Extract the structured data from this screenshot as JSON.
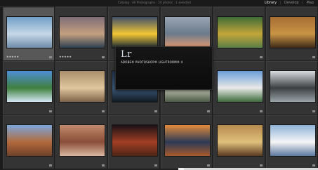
{
  "header": {
    "breadcrumb": "Catalog · All Photographs · 24 photos · 1 selected",
    "modules": [
      {
        "label": "Library",
        "active": true
      },
      {
        "label": "Develop",
        "active": false
      },
      {
        "label": "Map",
        "active": false
      }
    ]
  },
  "splash": {
    "logo": "Lr",
    "product": "ADOBE® PHOTOSHOP® LIGHTROOM® 4",
    "version": "",
    "credits": ""
  },
  "grid": {
    "rows": [
      [
        {
          "caption": "",
          "stars": "★★★★★",
          "palette": [
            "#6f9fc6",
            "#c7d7e7",
            "#6f8dab"
          ]
        },
        {
          "caption": "",
          "stars": "★★★★★",
          "palette": [
            "#7f6c78",
            "#c3a07f",
            "#2e4050"
          ]
        },
        {
          "caption": "",
          "stars": "",
          "palette": [
            "#3e4f6a",
            "#f2c634",
            "#1a2833"
          ]
        },
        {
          "caption": "",
          "stars": "",
          "palette": [
            "#9aa5b4",
            "#6a7b8b",
            "#e29b73"
          ]
        },
        {
          "caption": "",
          "stars": "",
          "palette": [
            "#3d6b37",
            "#c3a63a",
            "#5a7e44"
          ]
        },
        {
          "caption": "",
          "stars": "",
          "palette": [
            "#a76d33",
            "#c89445",
            "#3d2a18"
          ]
        }
      ],
      [
        {
          "caption": "",
          "stars": "",
          "palette": [
            "#4f8fd7",
            "#3f7f3f",
            "#d3e6f4"
          ]
        },
        {
          "caption": "",
          "stars": "",
          "palette": [
            "#a98f6b",
            "#e0c79e",
            "#7e6447"
          ]
        },
        {
          "caption": "",
          "stars": "",
          "palette": [
            "#22334a",
            "#3d5a7a",
            "#111a24"
          ]
        },
        {
          "caption": "",
          "stars": "",
          "palette": [
            "#6d7c6c",
            "#c5c7b7",
            "#4b5a45"
          ]
        },
        {
          "caption": "",
          "stars": "",
          "palette": [
            "#6a9ed7",
            "#e9e9e9",
            "#3b6a3b"
          ]
        },
        {
          "caption": "",
          "stars": "",
          "palette": [
            "#d9dde2",
            "#3b3f41",
            "#9aa3a8"
          ]
        }
      ],
      [
        {
          "caption": "",
          "stars": "",
          "palette": [
            "#7ca7d8",
            "#b2693d",
            "#6e4128"
          ]
        },
        {
          "caption": "",
          "stars": "",
          "palette": [
            "#c08a6b",
            "#8a4d38",
            "#d9b7a1"
          ]
        },
        {
          "caption": "",
          "stars": "",
          "palette": [
            "#1c1218",
            "#a03e24",
            "#4f2415"
          ]
        },
        {
          "caption": "",
          "stars": "",
          "palette": [
            "#e18b3b",
            "#2b3a55",
            "#a85a2d"
          ]
        },
        {
          "caption": "",
          "stars": "",
          "palette": [
            "#b68a4f",
            "#e0c07a",
            "#5a3a22"
          ]
        },
        {
          "caption": "",
          "stars": "",
          "palette": [
            "#8fb3d8",
            "#f5f5f5",
            "#5a78a0"
          ]
        }
      ]
    ]
  }
}
